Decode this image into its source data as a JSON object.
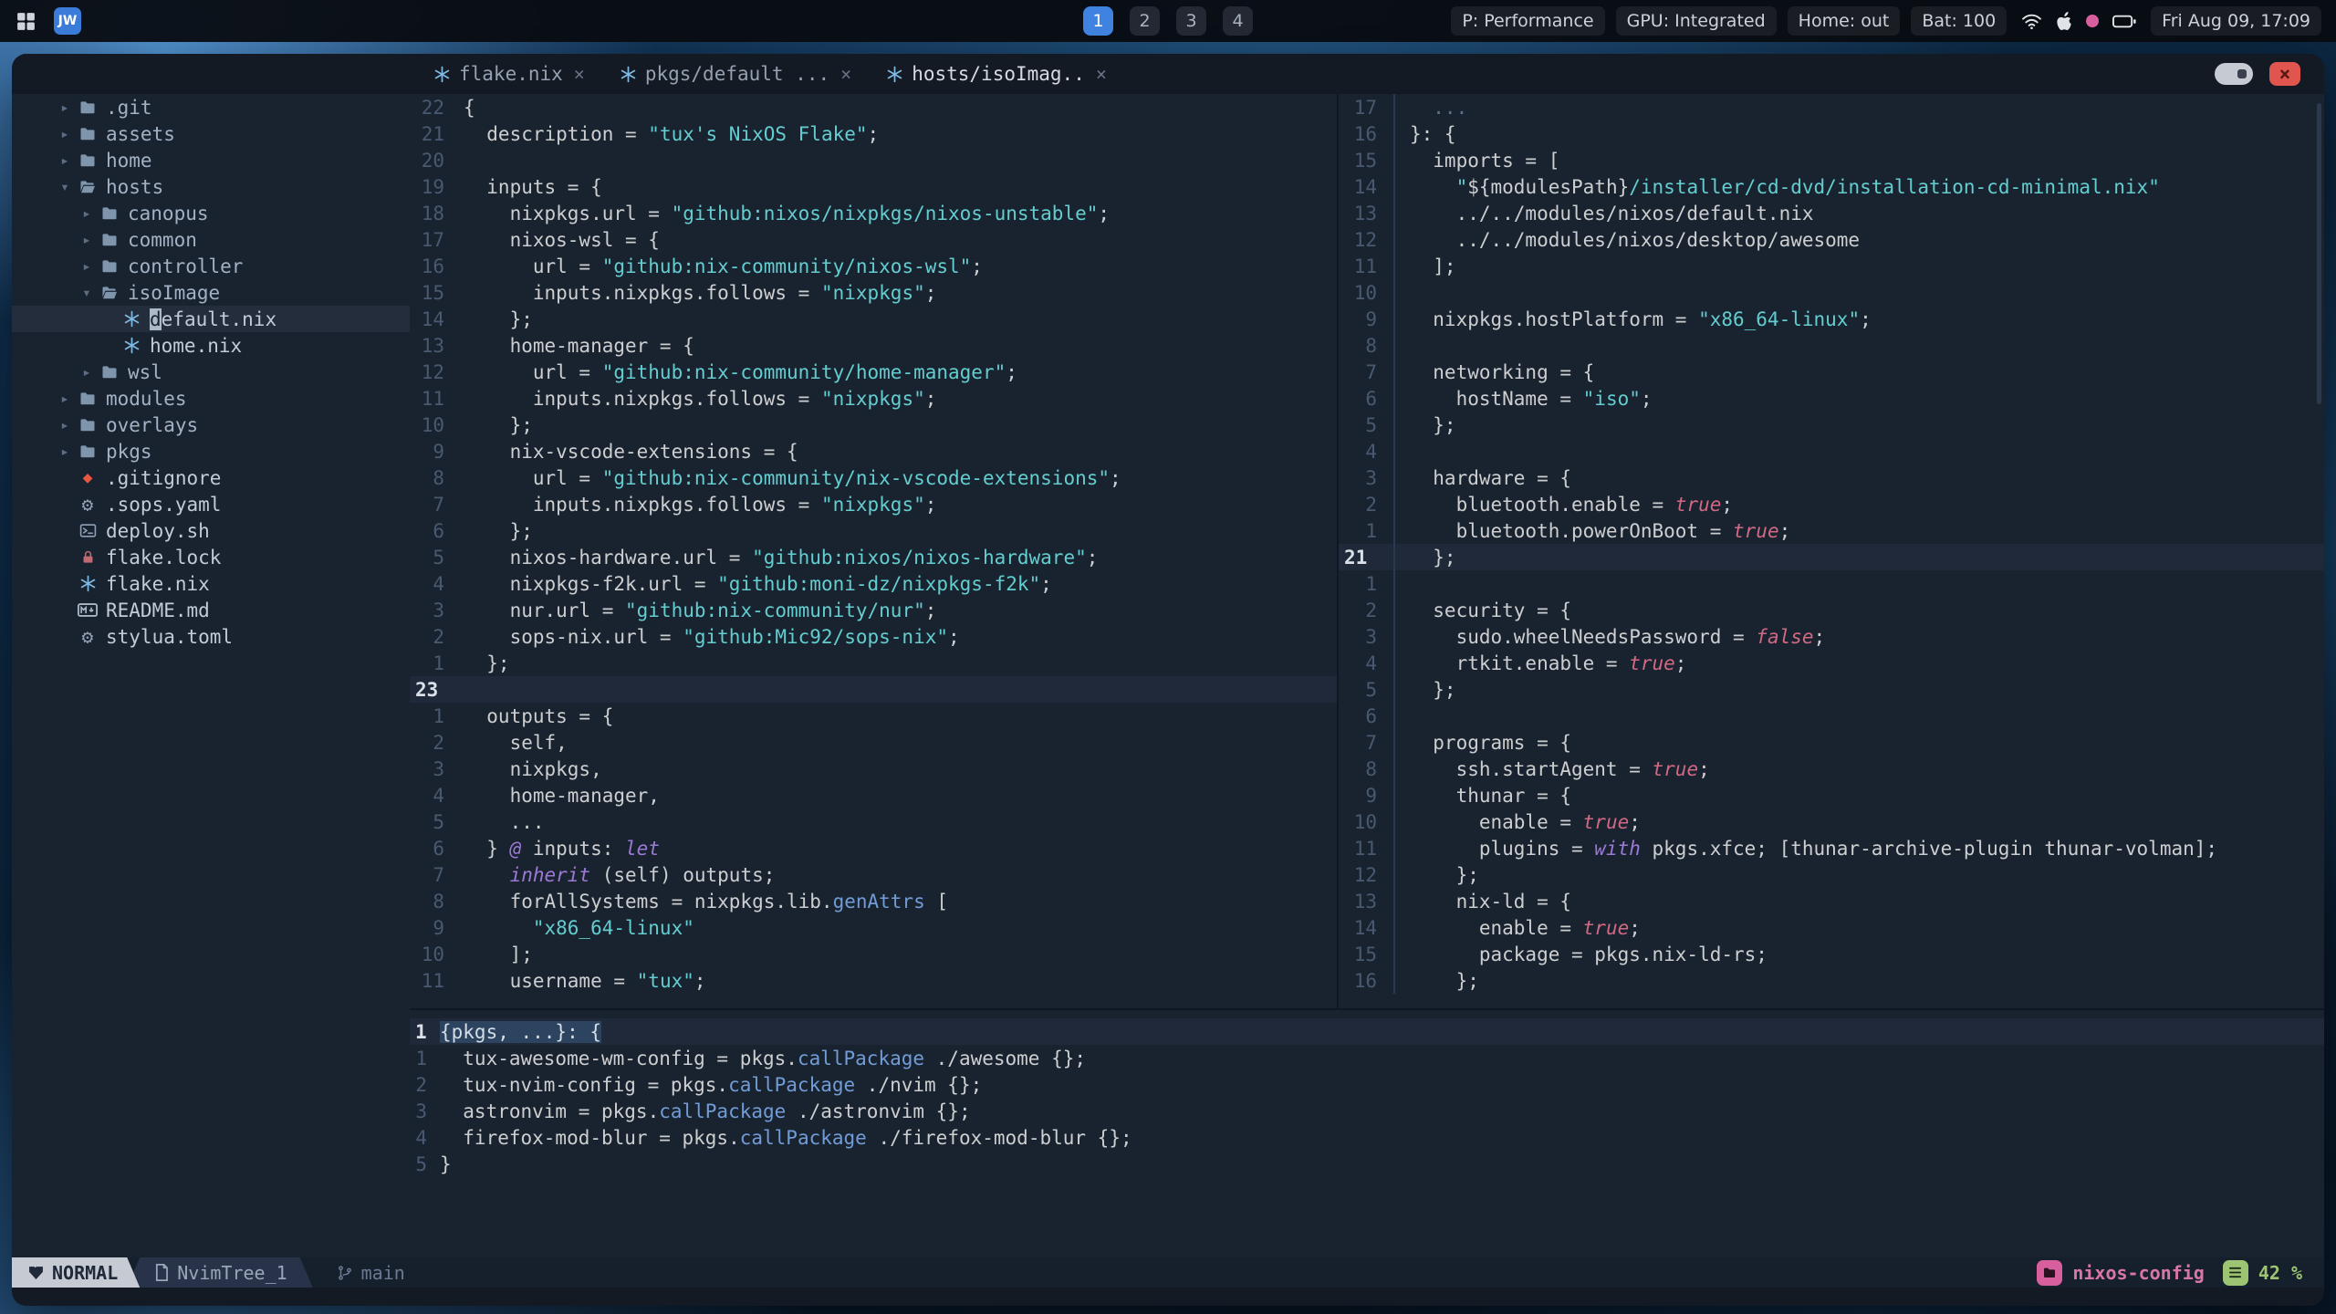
{
  "palette": {
    "editor_bg": "#192330",
    "panel_bg": "#131a24",
    "fg": "#cdcecf",
    "string": "#63cdcf",
    "keyword": "#9d79d6",
    "function": "#719cd6",
    "boolean": "#d16983",
    "line_number": "#49596f",
    "workspace_active_blue": "#3f82e0",
    "nix_icon_blue": "#7ebae4",
    "statusline_mode_bg": "#c6cbd3",
    "project_pink": "#d75f9e",
    "percent_green": "#9cc473",
    "close_button_red": "#e0564f"
  },
  "topbar": {
    "logo": "JW",
    "workspaces": {
      "items": [
        "1",
        "2",
        "3",
        "4"
      ],
      "active": "1"
    },
    "status": {
      "profile": "P: Performance",
      "gpu": "GPU: Integrated",
      "home": "Home: out",
      "battery": "Bat: 100",
      "clock": "Fri Aug 09, 17:09"
    }
  },
  "window": {
    "controls": {
      "close": "×"
    },
    "tabs": [
      {
        "label": "flake.nix",
        "close": "×",
        "active": false
      },
      {
        "label": "pkgs/default ...",
        "close": "×",
        "active": false
      },
      {
        "label": "hosts/isoImag..",
        "close": "×",
        "active": true
      }
    ]
  },
  "sidebar": {
    "items": [
      {
        "t": "dir",
        "label": ".git",
        "depth": 0,
        "state": "closed"
      },
      {
        "t": "dir",
        "label": "assets",
        "depth": 0,
        "state": "closed"
      },
      {
        "t": "dir",
        "label": "home",
        "depth": 0,
        "state": "closed"
      },
      {
        "t": "dir",
        "label": "hosts",
        "depth": 0,
        "state": "open"
      },
      {
        "t": "dir",
        "label": "canopus",
        "depth": 1,
        "state": "closed"
      },
      {
        "t": "dir",
        "label": "common",
        "depth": 1,
        "state": "closed"
      },
      {
        "t": "dir",
        "label": "controller",
        "depth": 1,
        "state": "closed"
      },
      {
        "t": "dir",
        "label": "isoImage",
        "depth": 1,
        "state": "open"
      },
      {
        "t": "file",
        "label": "default.nix",
        "depth": 2,
        "icon": "nix",
        "cursor": true
      },
      {
        "t": "file",
        "label": "home.nix",
        "depth": 2,
        "icon": "nix"
      },
      {
        "t": "dir",
        "label": "wsl",
        "depth": 1,
        "state": "closed"
      },
      {
        "t": "dir",
        "label": "modules",
        "depth": 0,
        "state": "closed"
      },
      {
        "t": "dir",
        "label": "overlays",
        "depth": 0,
        "state": "closed"
      },
      {
        "t": "dir",
        "label": "pkgs",
        "depth": 0,
        "state": "closed"
      },
      {
        "t": "file",
        "label": ".gitignore",
        "depth": 0,
        "icon": "git"
      },
      {
        "t": "file",
        "label": ".sops.yaml",
        "depth": 0,
        "icon": "gear"
      },
      {
        "t": "file",
        "label": "deploy.sh",
        "depth": 0,
        "icon": "shell"
      },
      {
        "t": "file",
        "label": "flake.lock",
        "depth": 0,
        "icon": "lock"
      },
      {
        "t": "file",
        "label": "flake.nix",
        "depth": 0,
        "icon": "nix"
      },
      {
        "t": "file",
        "label": "README.md",
        "depth": 0,
        "icon": "markdown"
      },
      {
        "t": "file",
        "label": "stylua.toml",
        "depth": 0,
        "icon": "gear"
      }
    ]
  },
  "editors": {
    "flake": {
      "lines": [
        {
          "n": "22",
          "t": [
            [
              "f",
              "{"
            ]
          ]
        },
        {
          "n": "21",
          "t": [
            [
              "f",
              "  description = "
            ],
            [
              "s",
              "\"tux's NixOS Flake\""
            ],
            [
              "f",
              ";"
            ]
          ]
        },
        {
          "n": "20",
          "t": []
        },
        {
          "n": "19",
          "t": [
            [
              "f",
              "  inputs = {"
            ]
          ]
        },
        {
          "n": "18",
          "t": [
            [
              "f",
              "    nixpkgs.url = "
            ],
            [
              "s",
              "\"github:nixos/nixpkgs/nixos-unstable\""
            ],
            [
              "f",
              ";"
            ]
          ]
        },
        {
          "n": "17",
          "t": [
            [
              "f",
              "    nixos-wsl = {"
            ]
          ]
        },
        {
          "n": "16",
          "t": [
            [
              "f",
              "      url = "
            ],
            [
              "s",
              "\"github:nix-community/nixos-wsl\""
            ],
            [
              "f",
              ";"
            ]
          ]
        },
        {
          "n": "15",
          "t": [
            [
              "f",
              "      inputs.nixpkgs.follows = "
            ],
            [
              "s",
              "\"nixpkgs\""
            ],
            [
              "f",
              ";"
            ]
          ]
        },
        {
          "n": "14",
          "t": [
            [
              "f",
              "    };"
            ]
          ]
        },
        {
          "n": "13",
          "t": [
            [
              "f",
              "    home-manager = {"
            ]
          ]
        },
        {
          "n": "12",
          "t": [
            [
              "f",
              "      url = "
            ],
            [
              "s",
              "\"github:nix-community/home-manager\""
            ],
            [
              "f",
              ";"
            ]
          ]
        },
        {
          "n": "11",
          "t": [
            [
              "f",
              "      inputs.nixpkgs.follows = "
            ],
            [
              "s",
              "\"nixpkgs\""
            ],
            [
              "f",
              ";"
            ]
          ]
        },
        {
          "n": "10",
          "t": [
            [
              "f",
              "    };"
            ]
          ]
        },
        {
          "n": "9",
          "t": [
            [
              "f",
              "    nix-vscode-extensions = {"
            ]
          ]
        },
        {
          "n": "8",
          "t": [
            [
              "f",
              "      url = "
            ],
            [
              "s",
              "\"github:nix-community/nix-vscode-extensions\""
            ],
            [
              "f",
              ";"
            ]
          ]
        },
        {
          "n": "7",
          "t": [
            [
              "f",
              "      inputs.nixpkgs.follows = "
            ],
            [
              "s",
              "\"nixpkgs\""
            ],
            [
              "f",
              ";"
            ]
          ]
        },
        {
          "n": "6",
          "t": [
            [
              "f",
              "    };"
            ]
          ]
        },
        {
          "n": "5",
          "t": [
            [
              "f",
              "    nixos-hardware.url = "
            ],
            [
              "s",
              "\"github:nixos/nixos-hardware\""
            ],
            [
              "f",
              ";"
            ]
          ]
        },
        {
          "n": "4",
          "t": [
            [
              "f",
              "    nixpkgs-f2k.url = "
            ],
            [
              "s",
              "\"github:moni-dz/nixpkgs-f2k\""
            ],
            [
              "f",
              ";"
            ]
          ]
        },
        {
          "n": "3",
          "t": [
            [
              "f",
              "    nur.url = "
            ],
            [
              "s",
              "\"github:nix-community/nur\""
            ],
            [
              "f",
              ";"
            ]
          ]
        },
        {
          "n": "2",
          "t": [
            [
              "f",
              "    sops-nix.url = "
            ],
            [
              "s",
              "\"github:Mic92/sops-nix\""
            ],
            [
              "f",
              ";"
            ]
          ]
        },
        {
          "n": "1",
          "t": [
            [
              "f",
              "  };"
            ]
          ]
        },
        {
          "n": "23",
          "c": true,
          "t": []
        },
        {
          "n": "1",
          "t": [
            [
              "f",
              "  outputs = {"
            ]
          ]
        },
        {
          "n": "2",
          "t": [
            [
              "f",
              "    self,"
            ]
          ]
        },
        {
          "n": "3",
          "t": [
            [
              "f",
              "    nixpkgs,"
            ]
          ]
        },
        {
          "n": "4",
          "t": [
            [
              "f",
              "    home-manager,"
            ]
          ]
        },
        {
          "n": "5",
          "t": [
            [
              "f",
              "    ..."
            ]
          ]
        },
        {
          "n": "6",
          "t": [
            [
              "f",
              "  } "
            ],
            [
              "k",
              "@"
            ],
            [
              "f",
              " inputs: "
            ],
            [
              "k",
              "let"
            ]
          ]
        },
        {
          "n": "7",
          "t": [
            [
              "f",
              "    "
            ],
            [
              "k",
              "inherit"
            ],
            [
              "f",
              " (self) outputs;"
            ]
          ]
        },
        {
          "n": "8",
          "t": [
            [
              "f",
              "    forAllSystems = nixpkgs.lib."
            ],
            [
              "fn",
              "genAttrs"
            ],
            [
              "f",
              " ["
            ]
          ]
        },
        {
          "n": "9",
          "t": [
            [
              "f",
              "      "
            ],
            [
              "s",
              "\"x86_64-linux\""
            ]
          ]
        },
        {
          "n": "10",
          "t": [
            [
              "f",
              "    ];"
            ]
          ]
        },
        {
          "n": "11",
          "t": [
            [
              "f",
              "    username = "
            ],
            [
              "s",
              "\"tux\""
            ],
            [
              "f",
              ";"
            ]
          ]
        }
      ]
    },
    "iso": {
      "lines": [
        {
          "n": "17",
          "t": [
            [
              "d",
              "  ..."
            ]
          ]
        },
        {
          "n": "16",
          "t": [
            [
              "f",
              "}: {"
            ]
          ]
        },
        {
          "n": "15",
          "t": [
            [
              "f",
              "  imports = ["
            ]
          ]
        },
        {
          "n": "14",
          "t": [
            [
              "s",
              "    \""
            ],
            [
              "i",
              "${"
            ],
            [
              "f",
              "modulesPath"
            ],
            [
              "i",
              "}"
            ],
            [
              "s",
              "/installer/cd-dvd/installation-cd-minimal.nix\""
            ]
          ]
        },
        {
          "n": "13",
          "t": [
            [
              "f",
              "    ../../modules/nixos/default.nix"
            ]
          ]
        },
        {
          "n": "12",
          "t": [
            [
              "f",
              "    ../../modules/nixos/desktop/awesome"
            ]
          ]
        },
        {
          "n": "11",
          "t": [
            [
              "f",
              "  ];"
            ]
          ]
        },
        {
          "n": "10",
          "t": []
        },
        {
          "n": "9",
          "t": [
            [
              "f",
              "  nixpkgs.hostPlatform = "
            ],
            [
              "s",
              "\"x86_64-linux\""
            ],
            [
              "f",
              ";"
            ]
          ]
        },
        {
          "n": "8",
          "t": []
        },
        {
          "n": "7",
          "t": [
            [
              "f",
              "  networking = {"
            ]
          ]
        },
        {
          "n": "6",
          "t": [
            [
              "f",
              "    hostName = "
            ],
            [
              "s",
              "\"iso\""
            ],
            [
              "f",
              ";"
            ]
          ]
        },
        {
          "n": "5",
          "t": [
            [
              "f",
              "  };"
            ]
          ]
        },
        {
          "n": "4",
          "t": []
        },
        {
          "n": "3",
          "t": [
            [
              "f",
              "  hardware = {"
            ]
          ]
        },
        {
          "n": "2",
          "t": [
            [
              "f",
              "    bluetooth.enable = "
            ],
            [
              "b",
              "true"
            ],
            [
              "f",
              ";"
            ]
          ]
        },
        {
          "n": "1",
          "t": [
            [
              "f",
              "    bluetooth.powerOnBoot = "
            ],
            [
              "b",
              "true"
            ],
            [
              "f",
              ";"
            ]
          ]
        },
        {
          "n": "21",
          "c": true,
          "t": [
            [
              "f",
              "  };"
            ]
          ]
        },
        {
          "n": "1",
          "t": []
        },
        {
          "n": "2",
          "t": [
            [
              "f",
              "  security = {"
            ]
          ]
        },
        {
          "n": "3",
          "t": [
            [
              "f",
              "    sudo.wheelNeedsPassword = "
            ],
            [
              "b",
              "false"
            ],
            [
              "f",
              ";"
            ]
          ]
        },
        {
          "n": "4",
          "t": [
            [
              "f",
              "    rtkit.enable = "
            ],
            [
              "b",
              "true"
            ],
            [
              "f",
              ";"
            ]
          ]
        },
        {
          "n": "5",
          "t": [
            [
              "f",
              "  };"
            ]
          ]
        },
        {
          "n": "6",
          "t": []
        },
        {
          "n": "7",
          "t": [
            [
              "f",
              "  programs = {"
            ]
          ]
        },
        {
          "n": "8",
          "t": [
            [
              "f",
              "    ssh.startAgent = "
            ],
            [
              "b",
              "true"
            ],
            [
              "f",
              ";"
            ]
          ]
        },
        {
          "n": "9",
          "t": [
            [
              "f",
              "    thunar = {"
            ]
          ]
        },
        {
          "n": "10",
          "t": [
            [
              "f",
              "      enable = "
            ],
            [
              "b",
              "true"
            ],
            [
              "f",
              ";"
            ]
          ]
        },
        {
          "n": "11",
          "t": [
            [
              "f",
              "      plugins = "
            ],
            [
              "k",
              "with"
            ],
            [
              "f",
              " pkgs.xfce; [thunar-archive-plugin thunar-volman];"
            ]
          ]
        },
        {
          "n": "12",
          "t": [
            [
              "f",
              "    };"
            ]
          ]
        },
        {
          "n": "13",
          "t": [
            [
              "f",
              "    nix-ld = {"
            ]
          ]
        },
        {
          "n": "14",
          "t": [
            [
              "f",
              "      enable = "
            ],
            [
              "b",
              "true"
            ],
            [
              "f",
              ";"
            ]
          ]
        },
        {
          "n": "15",
          "t": [
            [
              "f",
              "      package = pkgs.nix-ld-rs;"
            ]
          ]
        },
        {
          "n": "16",
          "t": [
            [
              "f",
              "    };"
            ]
          ]
        }
      ]
    },
    "pkgs": {
      "lines": [
        {
          "n": "1",
          "c": true,
          "t": [
            [
              "h",
              "{pkgs, ...}: {"
            ]
          ]
        },
        {
          "n": "1",
          "t": [
            [
              "f",
              "  tux-awesome-wm-config = pkgs."
            ],
            [
              "fn",
              "callPackage"
            ],
            [
              "f",
              " ./awesome {};"
            ]
          ]
        },
        {
          "n": "2",
          "t": [
            [
              "f",
              "  tux-nvim-config = pkgs."
            ],
            [
              "fn",
              "callPackage"
            ],
            [
              "f",
              " ./nvim {};"
            ]
          ]
        },
        {
          "n": "3",
          "t": [
            [
              "f",
              "  astronvim = pkgs."
            ],
            [
              "fn",
              "callPackage"
            ],
            [
              "f",
              " ./astronvim {};"
            ]
          ]
        },
        {
          "n": "4",
          "t": [
            [
              "f",
              "  firefox-mod-blur = pkgs."
            ],
            [
              "fn",
              "callPackage"
            ],
            [
              "f",
              " ./firefox-mod-blur {};"
            ]
          ]
        },
        {
          "n": "5",
          "t": [
            [
              "f",
              "}"
            ]
          ]
        }
      ]
    }
  },
  "statusline": {
    "mode": "NORMAL",
    "file": "NvimTree_1",
    "branch": "main",
    "project": "nixos-config",
    "percent": "42 %"
  }
}
